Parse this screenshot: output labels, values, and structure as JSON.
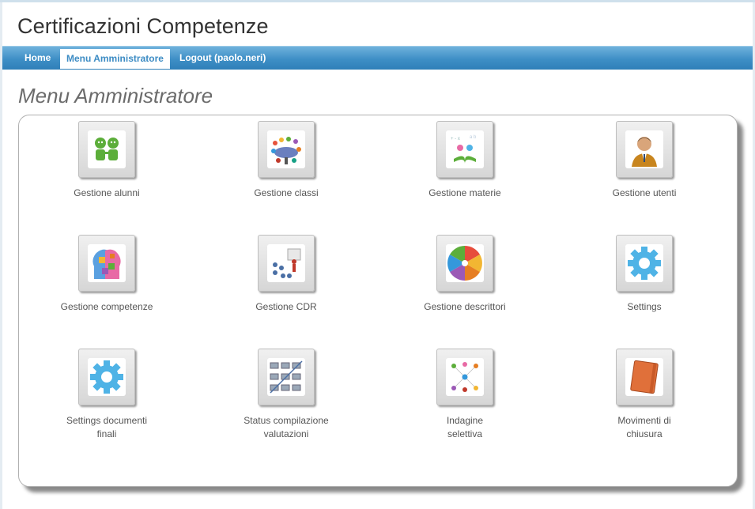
{
  "app_title": "Certificazioni Competenze",
  "nav": {
    "home": "Home",
    "admin_menu": "Menu Amministratore",
    "logout": "Logout (paolo.neri)"
  },
  "page_title": "Menu Amministratore",
  "items": [
    {
      "label": "Gestione alunni",
      "icon": "students-icon"
    },
    {
      "label": "Gestione classi",
      "icon": "classroom-meeting-icon"
    },
    {
      "label": "Gestione materie",
      "icon": "subjects-book-icon"
    },
    {
      "label": "Gestione utenti",
      "icon": "user-icon"
    },
    {
      "label": "Gestione competenze",
      "icon": "puzzle-head-icon"
    },
    {
      "label": "Gestione CDR",
      "icon": "presentation-icon"
    },
    {
      "label": "Gestione descrittori",
      "icon": "color-wheel-icon"
    },
    {
      "label": "Settings",
      "icon": "gear-icon"
    },
    {
      "label": "Settings documenti\nfinali",
      "icon": "gear-icon"
    },
    {
      "label": "Status compilazione\nvalutazioni",
      "icon": "workstations-icon"
    },
    {
      "label": "Indagine\nselettiva",
      "icon": "network-people-icon"
    },
    {
      "label": "Movimenti di\nchiusura",
      "icon": "notebook-icon"
    }
  ],
  "colors": {
    "nav_bar": "#3e8fc6",
    "gear": "#4fb3e6",
    "notebook": "#e0703a"
  }
}
